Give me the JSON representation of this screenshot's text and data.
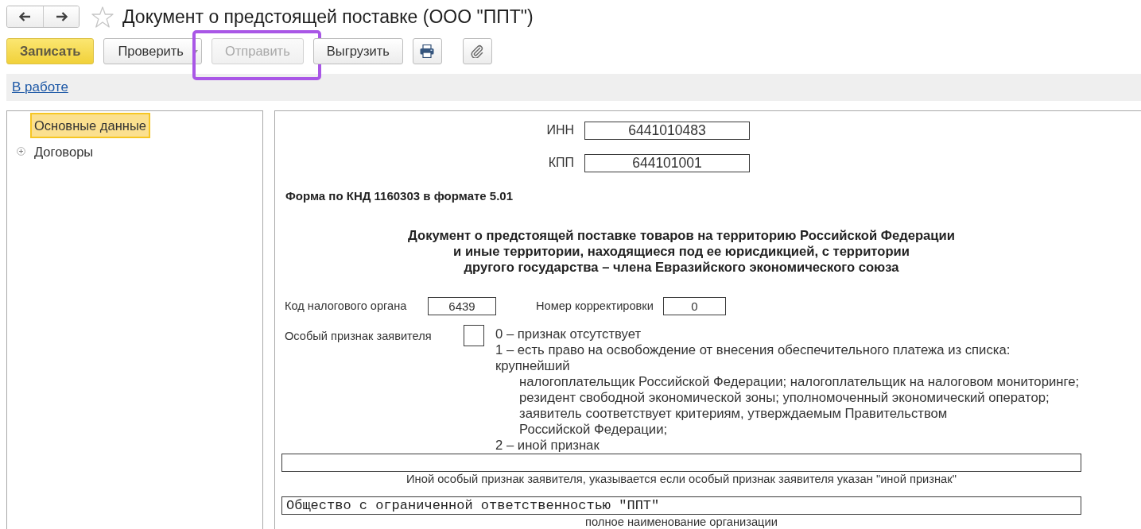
{
  "window": {
    "title": "Документ о предстоящей поставке (ООО \"ППТ\")"
  },
  "toolbar": {
    "buttons": [
      {
        "kind": "default",
        "label": "Записать",
        "disabled": false,
        "highlighted": false
      },
      {
        "kind": "dropdown",
        "label": "Проверить",
        "disabled": false,
        "highlighted": false
      },
      {
        "kind": "plain",
        "label": "Отправить",
        "disabled": true,
        "highlighted": true
      },
      {
        "kind": "plain",
        "label": "Выгрузить",
        "disabled": false,
        "highlighted": false
      }
    ]
  },
  "status_bar": {
    "link": "В работе"
  },
  "sidebar": {
    "items": [
      {
        "kind": "leaf",
        "label": "Основные данные",
        "selected": true
      },
      {
        "kind": "group",
        "label": "Договоры",
        "selected": false
      }
    ]
  },
  "form": {
    "inn": {
      "label": "ИНН",
      "value": "6441010483"
    },
    "kpp": {
      "label": "КПП",
      "value": "644101001"
    },
    "form_code": "Форма по КНД 1160303 в формате 5.01",
    "heading_lines": [
      "Документ о предстоящей поставке товаров на территорию Российской Федерации",
      "и иные территории, находящиеся под ее юрисдикцией, с территории",
      "другого государства – члена Евразийского экономического союза"
    ],
    "tax_office": {
      "label": "Код налогового органа",
      "value": "6439"
    },
    "correction": {
      "label": "Номер корректировки",
      "value": "0"
    },
    "applicant_sign": {
      "label": "Особый признак заявителя",
      "legend": [
        {
          "text": "0 – признак отсутствует"
        },
        {
          "text": "1 – есть право на освобождение от внесения обеспечительного платежа из списка:"
        },
        {
          "text": "крупнейший",
          "children": [
            {
              "text": "налогоплательщик Российской Федерации; налогоплательщик на налоговом мониторинге;"
            },
            {
              "text": "резидент свободной экономической зоны; уполномоченный экономический оператор;"
            },
            {
              "text": "заявитель соответствует критериям, утверждаемым Правительством"
            },
            {
              "text": "Российской Федерации;"
            }
          ]
        },
        {
          "text": "2 – иной признак"
        }
      ]
    },
    "other_sign": {
      "caption": "Иной особый признак заявителя, указывается если особый признак заявителя указан \"иной признак\""
    },
    "full_name": {
      "value": "Общество с ограниченной ответственностью \"ППТ\"",
      "caption": "полное наименование организации"
    }
  }
}
